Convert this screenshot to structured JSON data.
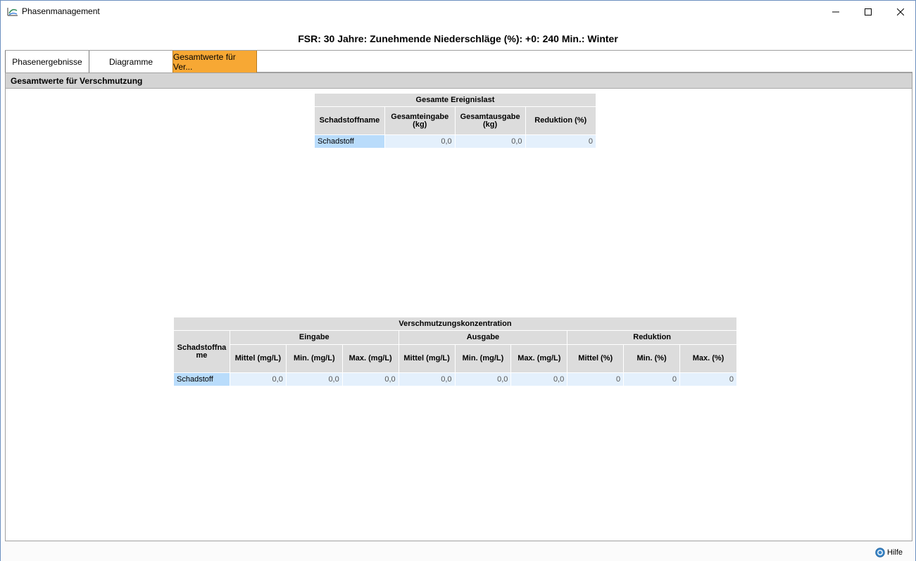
{
  "window": {
    "title": "Phasenmanagement"
  },
  "header": {
    "scenario": "FSR: 30 Jahre: Zunehmende Niederschläge (%): +0: 240 Min.: Winter"
  },
  "tabs": [
    {
      "label": "Phasenergebnisse",
      "active": false
    },
    {
      "label": "Diagramme",
      "active": false
    },
    {
      "label": "Gesamtwerte für Ver...",
      "active": true
    }
  ],
  "section": {
    "title": "Gesamtwerte für Verschmutzung"
  },
  "event_load": {
    "title": "Gesamte Ereignislast",
    "columns": [
      "Schadstoffname",
      "Gesamteingabe\n(kg)",
      "Gesamtausgabe\n(kg)",
      "Reduktion (%)"
    ],
    "rows": [
      {
        "name": "Schadstoff",
        "input": "0,0",
        "output": "0,0",
        "reduction": "0"
      }
    ]
  },
  "concentration": {
    "title": "Verschmutzungskonzentration",
    "name_header": "Schadstoffname",
    "groups": [
      "Eingabe",
      "Ausgabe",
      "Reduktion"
    ],
    "subcolumns": [
      "Mittel (mg/L)",
      "Min. (mg/L)",
      "Max. (mg/L)",
      "Mittel (mg/L)",
      "Min. (mg/L)",
      "Max. (mg/L)",
      "Mittel (%)",
      "Min. (%)",
      "Max. (%)"
    ],
    "rows": [
      {
        "name": "Schadstoff",
        "values": [
          "0,0",
          "0,0",
          "0,0",
          "0,0",
          "0,0",
          "0,0",
          "0",
          "0",
          "0"
        ]
      }
    ]
  },
  "footer": {
    "help_label": "Hilfe"
  },
  "colors": {
    "active_tab": "#f7a834",
    "name_cell": "#b9dcfb",
    "value_cell": "#e4f0fc",
    "header_gray": "#dcdcdc"
  }
}
